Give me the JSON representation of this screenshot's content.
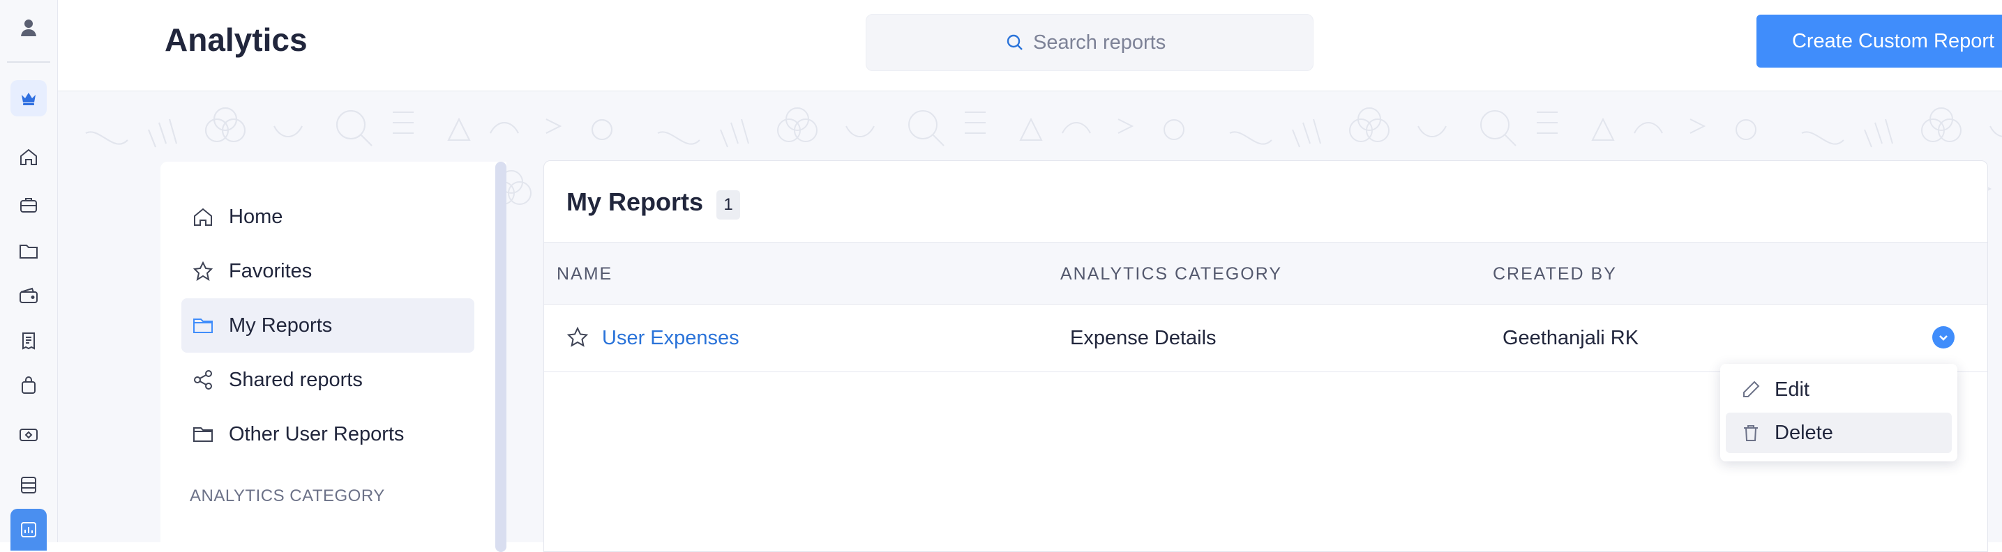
{
  "app": {
    "title": "Analytics"
  },
  "search": {
    "placeholder": "Search reports",
    "value": ""
  },
  "header": {
    "create_button_label": "Create Custom Report"
  },
  "rail": {
    "icons": [
      "user-avatar-icon",
      "crown-icon",
      "home-icon",
      "briefcase-icon",
      "folder-icon",
      "wallet-icon",
      "receipt-icon",
      "bag-icon",
      "cash-icon",
      "server-icon",
      "analytics-icon"
    ],
    "active": "analytics-icon"
  },
  "sidebar": {
    "items": [
      {
        "label": "Home",
        "icon": "home-icon"
      },
      {
        "label": "Favorites",
        "icon": "star-icon"
      },
      {
        "label": "My Reports",
        "icon": "folder-icon",
        "selected": true
      },
      {
        "label": "Shared reports",
        "icon": "share-icon"
      },
      {
        "label": "Other User Reports",
        "icon": "folder-icon"
      }
    ],
    "section_heading": "ANALYTICS CATEGORY"
  },
  "reports": {
    "title": "My Reports",
    "count": "1",
    "columns": [
      "NAME",
      "ANALYTICS CATEGORY",
      "CREATED BY"
    ],
    "rows": [
      {
        "name": "User Expenses",
        "category": "Expense Details",
        "created_by": "Geethanjali RK"
      }
    ]
  },
  "row_menu": {
    "items": [
      {
        "label": "Edit",
        "icon": "pencil-icon"
      },
      {
        "label": "Delete",
        "icon": "trash-icon",
        "hovered": true
      }
    ]
  },
  "colors": {
    "accent": "#408dfb",
    "link": "#2a73d9",
    "text": "#21263c",
    "muted": "#6c7288",
    "selected_bg": "#eef0f8"
  }
}
